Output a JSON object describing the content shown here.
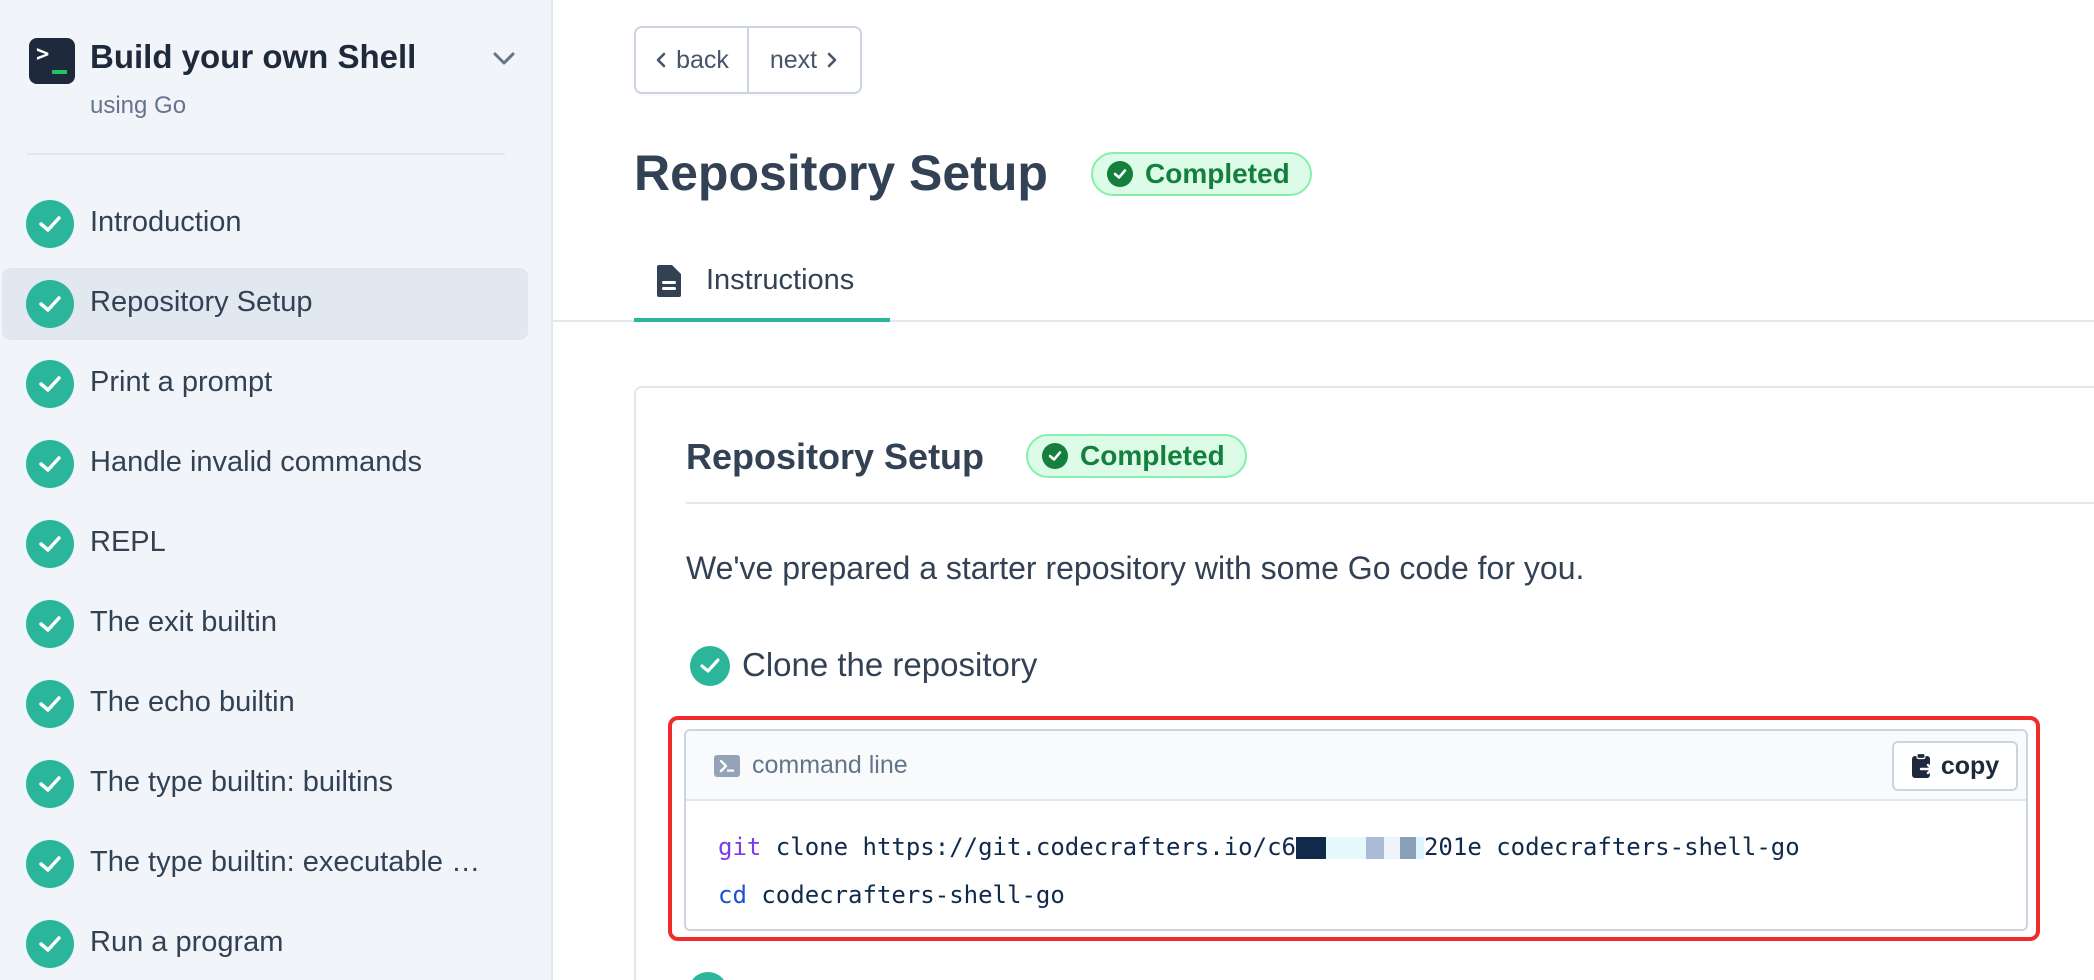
{
  "sidebar": {
    "title": "Build your own Shell",
    "subtitle": "using Go",
    "items": [
      {
        "label": "Introduction",
        "active": false
      },
      {
        "label": "Repository Setup",
        "active": true
      },
      {
        "label": "Print a prompt",
        "active": false
      },
      {
        "label": "Handle invalid commands",
        "active": false
      },
      {
        "label": "REPL",
        "active": false
      },
      {
        "label": "The exit builtin",
        "active": false
      },
      {
        "label": "The echo builtin",
        "active": false
      },
      {
        "label": "The type builtin: builtins",
        "active": false
      },
      {
        "label": "The type builtin: executable …",
        "active": false
      },
      {
        "label": "Run a program",
        "active": false
      }
    ]
  },
  "nav": {
    "back_label": "back",
    "next_label": "next"
  },
  "header": {
    "title": "Repository Setup",
    "status": "Completed"
  },
  "tabs": [
    {
      "label": "Instructions"
    }
  ],
  "card": {
    "title": "Repository Setup",
    "status": "Completed",
    "intro": "We've prepared a starter repository with some Go code for you.",
    "step_label": "Clone the repository",
    "code": {
      "header": "command line",
      "copy_label": "copy",
      "line1_cmd": "git",
      "line1_rest_a": " clone https://git.codecrafters.io/c6",
      "line1_rest_b": "201e codecrafters-shell-go",
      "line2_cmd": "cd",
      "line2_rest": " codecrafters-shell-go"
    }
  },
  "colors": {
    "accent": "#2bb59a",
    "badge_green": "#15803d",
    "highlight_red": "#ef2b2b"
  }
}
